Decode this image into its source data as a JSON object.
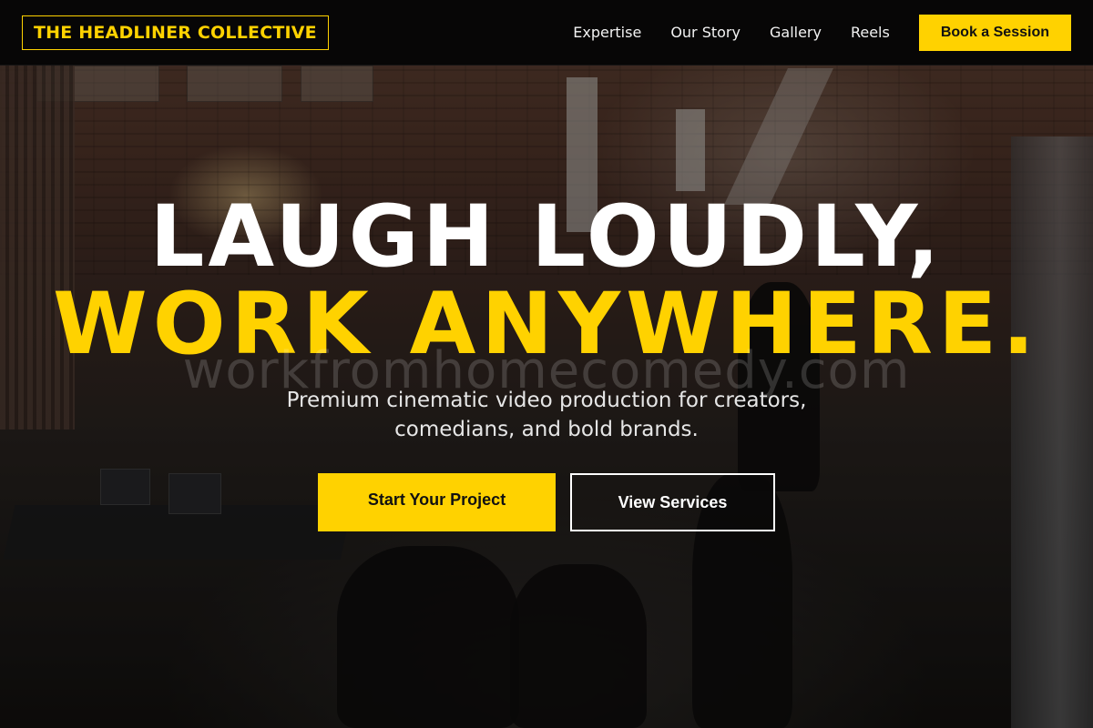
{
  "nav": {
    "logo": "THE HEADLINER COLLECTIVE",
    "links": [
      "Expertise",
      "Our Story",
      "Gallery",
      "Reels"
    ],
    "book_label": "Book a Session"
  },
  "hero": {
    "headline_line1": "LAUGH LOUDLY,",
    "headline_line2": "WORK ANYWHERE.",
    "watermark": "workfromhomecomedy.com",
    "subtitle": "Premium cinematic video production for creators, comedians, and bold brands.",
    "cta_primary": "Start Your Project",
    "cta_secondary": "View Services"
  },
  "colors": {
    "accent": "#ffd200",
    "nav_background": "#050505",
    "text": "#ffffff"
  }
}
